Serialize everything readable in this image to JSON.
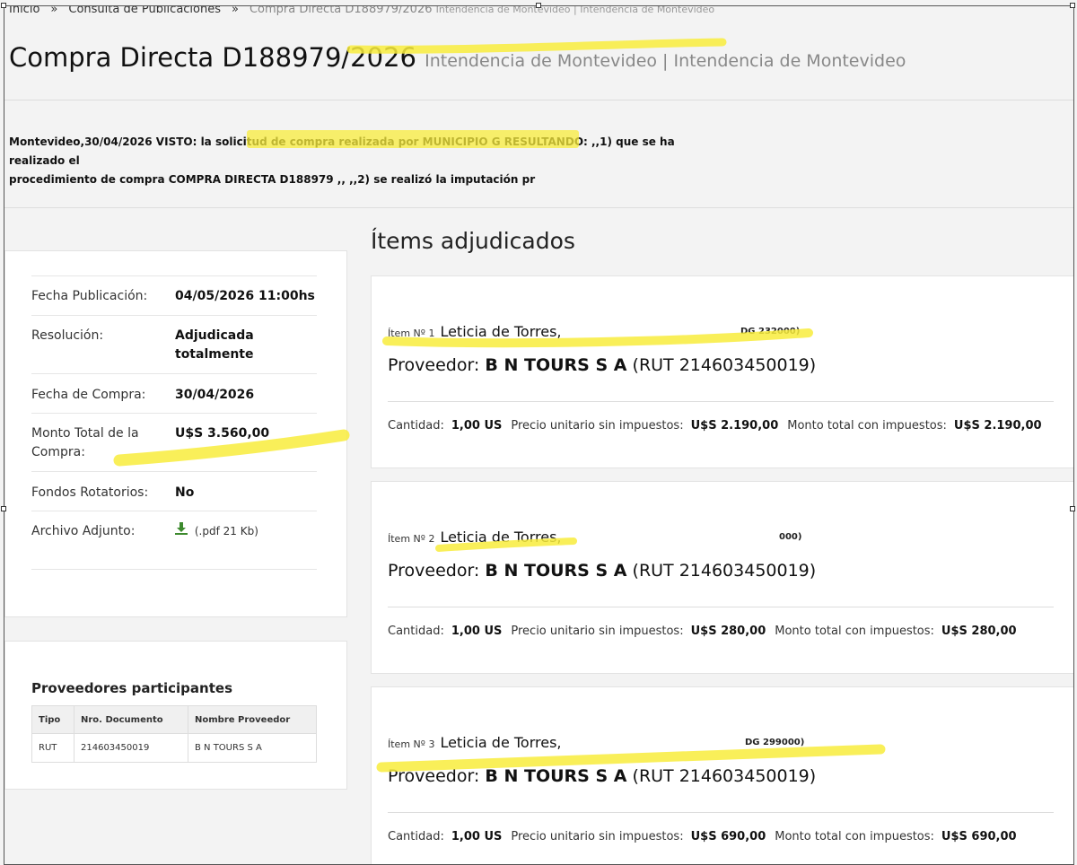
{
  "breadcrumb": {
    "home": "Inicio",
    "sep": "»",
    "section": "Consulta de Publicaciones",
    "current": "Compra Directa D188979/2026",
    "current_sub": "Intendencia de Montevideo | Intendencia de Montevideo"
  },
  "header": {
    "title": "Compra Directa D188979/2026",
    "subtitle": "Intendencia de Montevideo | Intendencia de Montevideo"
  },
  "description": {
    "line1": "Montevideo,30/04/2026 VISTO: la solicitud de compra realizada por MUNICIPIO G RESULTANDO: ,,1) que se ha realizado el",
    "line2": "procedimiento de compra COMPRA DIRECTA D188979 ,, ,,2) se realizó la imputación pr"
  },
  "info": {
    "fecha_publicacion_label": "Fecha Publicación:",
    "fecha_publicacion_value": "04/05/2026 11:00hs",
    "resolucion_label": "Resolución:",
    "resolucion_value": "Adjudicada totalmente",
    "fecha_compra_label": "Fecha de Compra:",
    "fecha_compra_value": "30/04/2026",
    "monto_label": "Monto Total de la Compra:",
    "monto_value": "U$S 3.560,00",
    "fondos_label": "Fondos Rotatorios:",
    "fondos_value": "No",
    "archivo_label": "Archivo Adjunto:",
    "archivo_value": "(.pdf 21 Kb)",
    "archivo_icon": "download-icon"
  },
  "proveedores": {
    "title": "Proveedores participantes",
    "columns": [
      "Tipo",
      "Nro. Documento",
      "Nombre Proveedor"
    ],
    "rows": [
      [
        "RUT",
        "214603450019",
        "B N TOURS S A"
      ]
    ]
  },
  "items": {
    "title": "Ítems adjudicados",
    "list": [
      {
        "no": "Ítem Nº 1",
        "name": "Leticia de Torres,",
        "tail": "DG 232000)",
        "prov_label": "Proveedor:",
        "prov_name": "B N TOURS S A",
        "prov_rut": "(RUT 214603450019)",
        "cant_label": "Cantidad:",
        "cant_value": "1,00 US",
        "precio_label": "Precio unitario sin impuestos:",
        "precio_value": "U$S 2.190,00",
        "monto_label": "Monto total con impuestos:",
        "monto_value": "U$S 2.190,00"
      },
      {
        "no": "Ítem Nº 2",
        "name": "Leticia de Torres,",
        "tail": "000)",
        "prov_label": "Proveedor:",
        "prov_name": "B N TOURS S A",
        "prov_rut": "(RUT 214603450019)",
        "cant_label": "Cantidad:",
        "cant_value": "1,00 US",
        "precio_label": "Precio unitario sin impuestos:",
        "precio_value": "U$S 280,00",
        "monto_label": "Monto total con impuestos:",
        "monto_value": "U$S 280,00"
      },
      {
        "no": "Ítem Nº 3",
        "name": "Leticia de Torres,",
        "tail": "DG 299000)",
        "prov_label": "Proveedor:",
        "prov_name": "B N TOURS S A",
        "prov_rut": "(RUT 214603450019)",
        "cant_label": "Cantidad:",
        "cant_value": "1,00 US",
        "precio_label": "Precio unitario sin impuestos:",
        "precio_value": "U$S 690,00",
        "monto_label": "Monto total con impuestos:",
        "monto_value": "U$S 690,00"
      }
    ]
  },
  "colors": {
    "highlight": "#f8ec3c",
    "download": "#3d8a2e",
    "background": "#f3f3f3"
  }
}
